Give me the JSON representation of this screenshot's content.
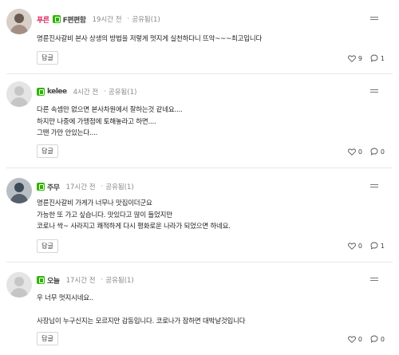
{
  "comments": [
    {
      "avatar": "photo",
      "nick_prefix": "푸른",
      "nickname": "F편편함",
      "time": "19시간 전",
      "shares": "공유됨(1)",
      "text": "명륜진사갈비 본사 상생의 방법을 저렇게 멋지게 실천하다니 뜨악~~~최고입니다",
      "reply_label": "답글",
      "likes": "9",
      "replies": "1"
    },
    {
      "avatar": "default",
      "nick_prefix": "",
      "nickname": "kelee",
      "time": "4시간 전",
      "shares": "공유됨(1)",
      "text": "다른 속셈만 없으면 본사차원에서 잘하는것 같네요....\n하지만 나중에 가맹점에 토해놓라고 하면....\n그땐 가만 안있는다....",
      "reply_label": "답글",
      "likes": "0",
      "replies": "0"
    },
    {
      "avatar": "photo",
      "nick_prefix": "",
      "nickname": "주무",
      "time": "17시간 전",
      "shares": "공유됨(1)",
      "text": "명륜진사갈비 가게가 너무나 맛집이더군요\n가능한 또 가고 싶습니다. 맛있다고 많이 들었지만\n코로나 싹~ 사라지고 쾌적하게 다시 평화로운 나라가 되었으면 하네요.",
      "reply_label": "답글",
      "likes": "0",
      "replies": "1"
    },
    {
      "avatar": "default",
      "nick_prefix": "",
      "nickname": "오늘",
      "time": "17시간 전",
      "shares": "공유됨(1)",
      "text": "우 너무 멋지시네요..\n\n사장님이 누구신지는 모르지만 감동입니다. 코로나가 잠하면 대박날것입니다",
      "reply_label": "답글",
      "likes": "0",
      "replies": "0"
    }
  ],
  "icons": {
    "more": "more-menu-icon",
    "like": "heart-icon",
    "reply_count": "comment-bubble-icon",
    "badge": "naver-badge-icon"
  },
  "colors": {
    "badge_green": "#2db400",
    "nick_prefix_red": "#e0245e"
  }
}
